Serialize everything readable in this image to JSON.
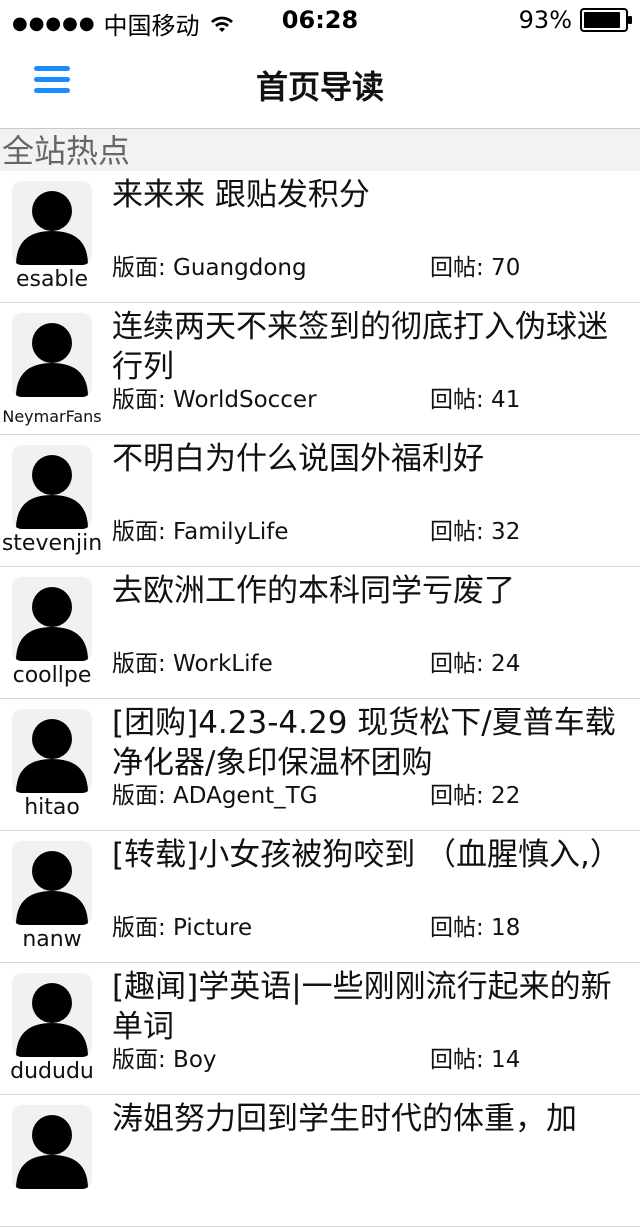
{
  "status_bar": {
    "carrier": "中国移动",
    "time": "06:28",
    "battery": "93%"
  },
  "nav": {
    "title": "首页导读",
    "menu_icon": "hamburger-menu-icon",
    "accent_color": "#1a8cff"
  },
  "section": {
    "title": "全站热点"
  },
  "posts": [
    {
      "user": "esable",
      "title": "来来来 跟贴发积分",
      "board": "版面: Guangdong",
      "replies": "回帖: 70"
    },
    {
      "user": "NeymarFans",
      "title": "连续两天不来签到的彻底打入伪球迷行列",
      "board": "版面: WorldSoccer",
      "replies": "回帖: 41"
    },
    {
      "user": "stevenjin",
      "title": "不明白为什么说国外福利好",
      "board": "版面: FamilyLife",
      "replies": "回帖: 32"
    },
    {
      "user": "coollpe",
      "title": "去欧洲工作的本科同学亏废了",
      "board": "版面: WorkLife",
      "replies": "回帖: 24"
    },
    {
      "user": "hitao",
      "title": "[团购]4.23-4.29 现货松下/夏普车载净化器/象印保温杯团购",
      "board": "版面: ADAgent_TG",
      "replies": "回帖: 22"
    },
    {
      "user": "nanw",
      "title": "[转载]小女孩被狗咬到 （血腥慎入,）",
      "board": "版面: Picture",
      "replies": "回帖: 18"
    },
    {
      "user": "dududu",
      "title": "[趣闻]学英语|一些刚刚流行起来的新单词",
      "board": "版面: Boy",
      "replies": "回帖: 14"
    },
    {
      "user": "",
      "title": "涛姐努力回到学生时代的体重，加",
      "board": "",
      "replies": ""
    }
  ]
}
